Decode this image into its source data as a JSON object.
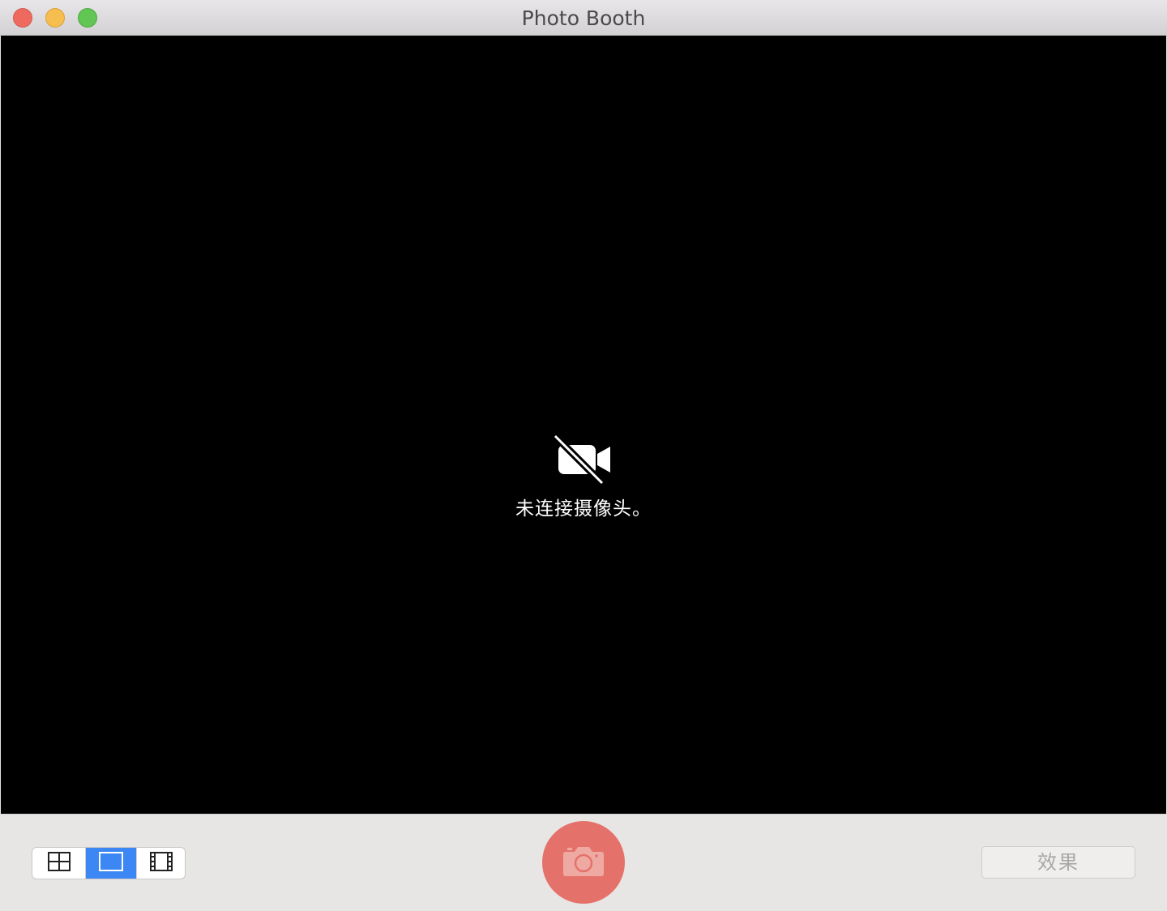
{
  "window": {
    "title": "Photo Booth"
  },
  "viewport": {
    "message": "未连接摄像头。",
    "icon": "video-camera-slash-icon"
  },
  "toolbar": {
    "layout_options": [
      {
        "name": "four-photo-layout",
        "icon": "grid-2x2-icon",
        "selected": false
      },
      {
        "name": "single-photo-layout",
        "icon": "single-frame-icon",
        "selected": true
      },
      {
        "name": "video-layout",
        "icon": "film-strip-icon",
        "selected": false
      }
    ],
    "shutter_icon": "camera-icon",
    "effects_label": "效果"
  },
  "colors": {
    "close": "#ee6a5f",
    "minimize": "#f6be4f",
    "maximize": "#62c655",
    "selected_segment": "#3d87f5",
    "shutter": "#e5726a"
  }
}
